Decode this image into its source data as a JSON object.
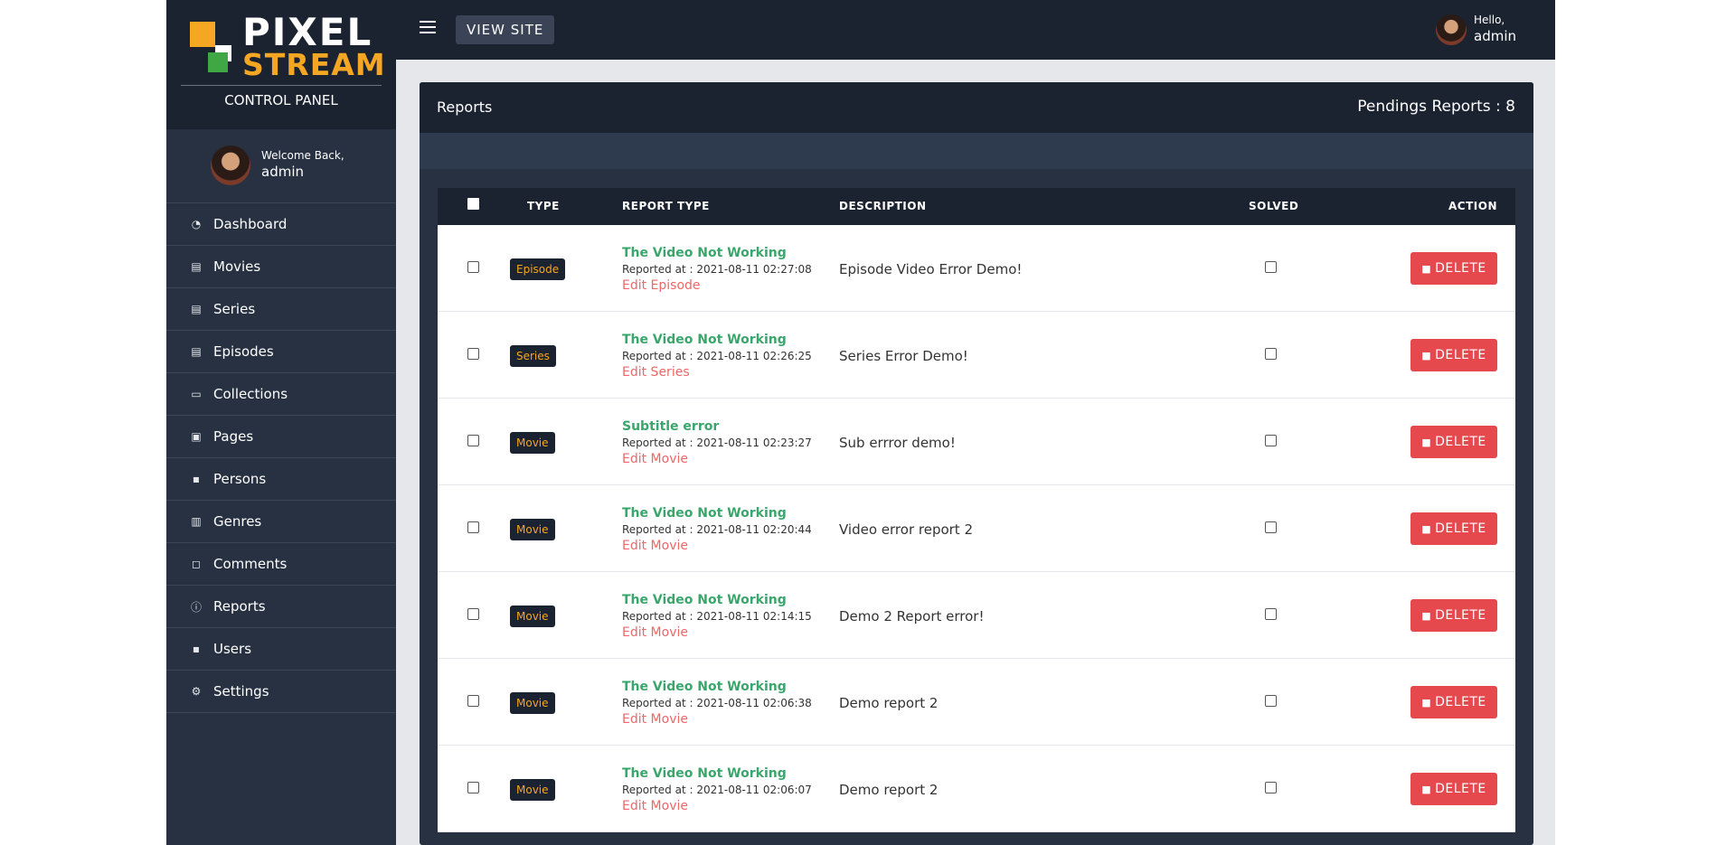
{
  "brand": {
    "logo_top": "PIXEL",
    "logo_bottom": "STREAM",
    "panel_label": "CONTROL PANEL"
  },
  "sidebar_user": {
    "welcome": "Welcome Back,",
    "name": "admin"
  },
  "menu": [
    {
      "label": "Dashboard",
      "icon": "speedometer-icon",
      "glyph": "◔"
    },
    {
      "label": "Movies",
      "icon": "film-icon",
      "glyph": "▤"
    },
    {
      "label": "Series",
      "icon": "film-icon",
      "glyph": "▤"
    },
    {
      "label": "Episodes",
      "icon": "film-icon",
      "glyph": "▤"
    },
    {
      "label": "Collections",
      "icon": "folder-icon",
      "glyph": "▭"
    },
    {
      "label": "Pages",
      "icon": "pages-icon",
      "glyph": "▣"
    },
    {
      "label": "Persons",
      "icon": "people-icon",
      "glyph": "▪"
    },
    {
      "label": "Genres",
      "icon": "clapper-icon",
      "glyph": "▥"
    },
    {
      "label": "Comments",
      "icon": "comment-icon",
      "glyph": "◻"
    },
    {
      "label": "Reports",
      "icon": "info-icon",
      "glyph": "ⓘ"
    },
    {
      "label": "Users",
      "icon": "users-icon",
      "glyph": "▪"
    },
    {
      "label": "Settings",
      "icon": "gear-icon",
      "glyph": "⚙"
    }
  ],
  "topbar": {
    "view_site": "VIEW SITE",
    "hello": "Hello,",
    "user": "admin"
  },
  "card": {
    "title": "Reports",
    "pending": "Pendings Reports : 8"
  },
  "table": {
    "headers": {
      "type": "TYPE",
      "report_type": "REPORT TYPE",
      "description": "DESCRIPTION",
      "solved": "SOLVED",
      "action": "ACTION"
    },
    "delete_label": "DELETE",
    "rows": [
      {
        "type": "Episode",
        "report": "The Video Not Working",
        "reported_at": "Reported at : 2021-08-11 02:27:08",
        "edit": "Edit Episode",
        "description": "Episode Video Error Demo!"
      },
      {
        "type": "Series",
        "report": "The Video Not Working",
        "reported_at": "Reported at : 2021-08-11 02:26:25",
        "edit": "Edit Series",
        "description": "Series Error Demo!"
      },
      {
        "type": "Movie",
        "report": "Subtitle error",
        "reported_at": "Reported at : 2021-08-11 02:23:27",
        "edit": "Edit Movie",
        "description": "Sub errror demo!"
      },
      {
        "type": "Movie",
        "report": "The Video Not Working",
        "reported_at": "Reported at : 2021-08-11 02:20:44",
        "edit": "Edit Movie",
        "description": "Video error report 2"
      },
      {
        "type": "Movie",
        "report": "The Video Not Working",
        "reported_at": "Reported at : 2021-08-11 02:14:15",
        "edit": "Edit Movie",
        "description": "Demo 2 Report error!"
      },
      {
        "type": "Movie",
        "report": "The Video Not Working",
        "reported_at": "Reported at : 2021-08-11 02:06:38",
        "edit": "Edit Movie",
        "description": "Demo report 2"
      },
      {
        "type": "Movie",
        "report": "The Video Not Working",
        "reported_at": "Reported at : 2021-08-11 02:06:07",
        "edit": "Edit Movie",
        "description": "Demo report 2"
      }
    ]
  },
  "colors": {
    "sidebar": "#273142",
    "topbar": "#1b2230",
    "accent": "#f5a623",
    "green": "#3aa66b",
    "danger": "#e5484d"
  }
}
